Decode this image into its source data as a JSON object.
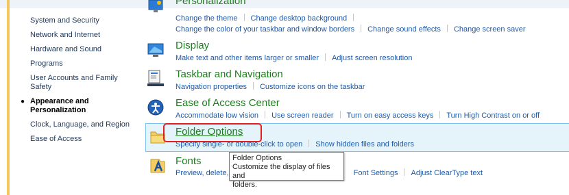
{
  "sidebar": {
    "items": [
      {
        "label": "System and Security"
      },
      {
        "label": "Network and Internet"
      },
      {
        "label": "Hardware and Sound"
      },
      {
        "label": "Programs"
      },
      {
        "label": "User Accounts and Family Safety"
      },
      {
        "label": "Appearance and Personalization",
        "active": true
      },
      {
        "label": "Clock, Language, and Region"
      },
      {
        "label": "Ease of Access"
      }
    ],
    "bullet": "●"
  },
  "categories": {
    "personalization": {
      "title": "Personalization",
      "links_row1": [
        "Change the theme",
        "Change desktop background"
      ],
      "links_row2": [
        "Change the color of your taskbar and window borders",
        "Change sound effects",
        "Change screen saver"
      ]
    },
    "display": {
      "title": "Display",
      "links": [
        "Make text and other items larger or smaller",
        "Adjust screen resolution"
      ]
    },
    "taskbar": {
      "title": "Taskbar and Navigation",
      "links": [
        "Navigation properties",
        "Customize icons on the taskbar"
      ]
    },
    "ease": {
      "title": "Ease of Access Center",
      "links": [
        "Accommodate low vision",
        "Use screen reader",
        "Turn on easy access keys",
        "Turn High Contrast on or off"
      ]
    },
    "folder": {
      "title": "Folder Options",
      "links": [
        "Specify single- or double-click to open",
        "Show hidden files and folders"
      ]
    },
    "fonts": {
      "title": "Fonts",
      "links": [
        "Preview, delete,",
        "Font Settings",
        "Adjust ClearType text"
      ]
    }
  },
  "tooltip": {
    "title": "Folder Options",
    "line1": "Customize the display of files and",
    "line2": "folders."
  },
  "colors": {
    "accent_bar": "#f2c75c",
    "title_green": "#1e7d1e",
    "link_blue": "#1e5aa8",
    "highlight": "#e5f3fb",
    "callout_red": "#e02020"
  },
  "icons": [
    "personalization-icon",
    "display-icon",
    "taskbar-icon",
    "ease-of-access-icon",
    "folder-icon",
    "fonts-icon"
  ]
}
